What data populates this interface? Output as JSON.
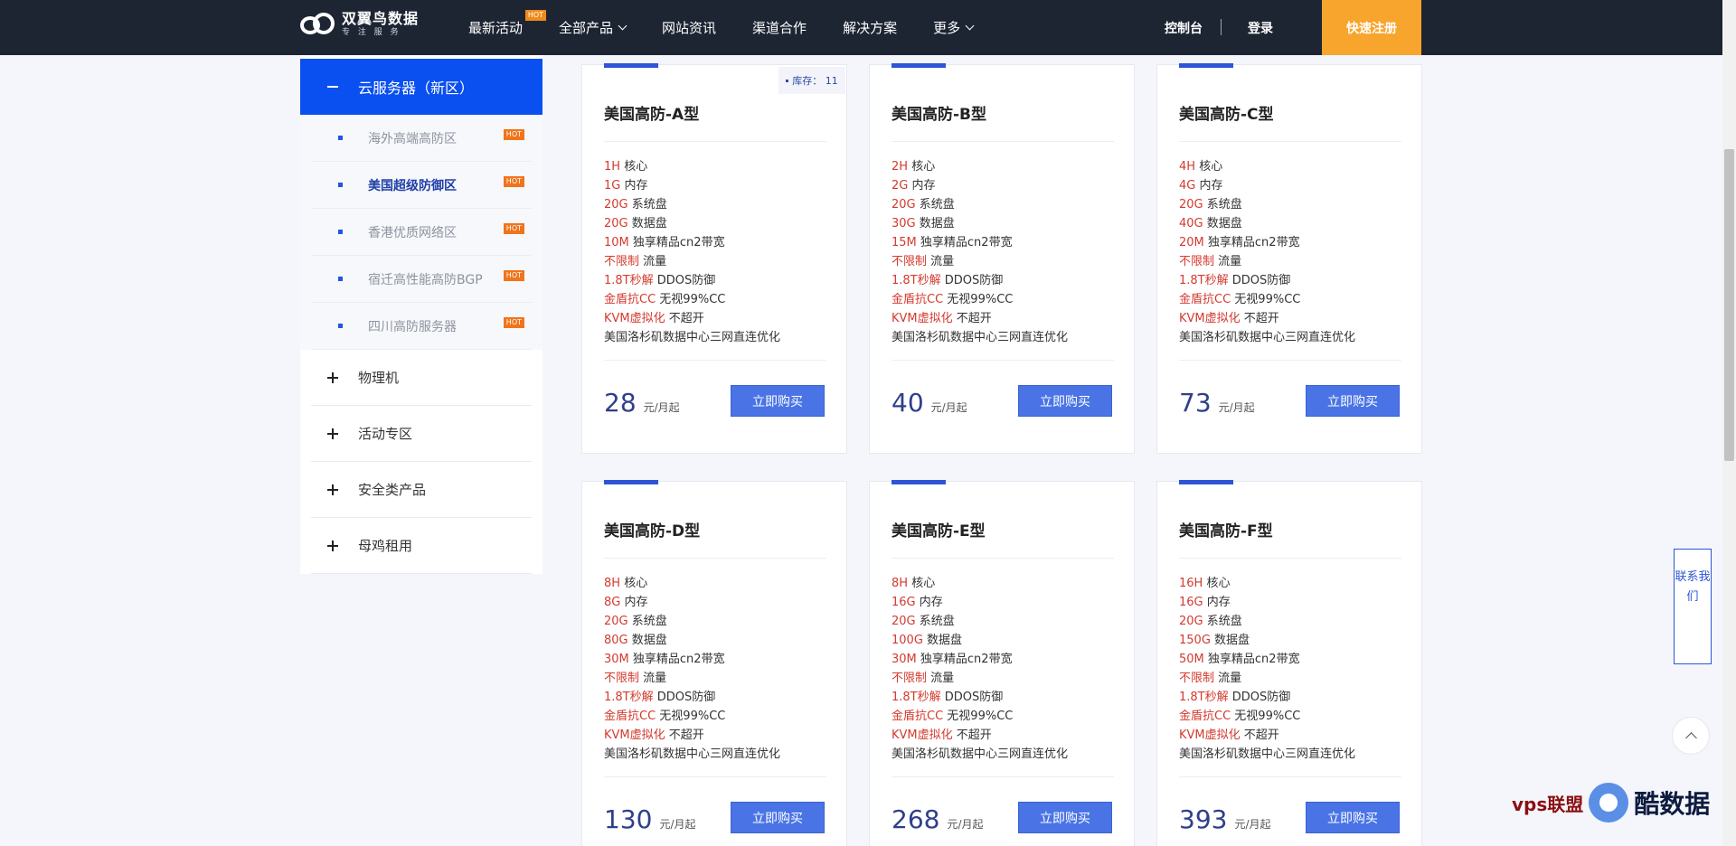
{
  "header": {
    "logo_name": "双翼鸟数据",
    "logo_sub": "专 注 服 务",
    "nav": [
      {
        "label": "最新活动",
        "hot": "HOT",
        "dropdown": false
      },
      {
        "label": "全部产品",
        "hot": "",
        "dropdown": true
      },
      {
        "label": "网站资讯",
        "hot": "",
        "dropdown": false
      },
      {
        "label": "渠道合作",
        "hot": "",
        "dropdown": false
      },
      {
        "label": "解决方案",
        "hot": "",
        "dropdown": false
      },
      {
        "label": "更多",
        "hot": "",
        "dropdown": true
      }
    ],
    "console": "控制台",
    "login": "登录",
    "register": "快速注册"
  },
  "sidebar": {
    "active": "云服务器（新区）",
    "subs": [
      {
        "label": "海外高端高防区",
        "hot": "HOT"
      },
      {
        "label": "美国超级防御区",
        "hot": "HOT"
      },
      {
        "label": "香港优质网络区",
        "hot": "HOT"
      },
      {
        "label": "宿迁高性能高防BGP",
        "hot": "HOT"
      },
      {
        "label": "四川高防服务器",
        "hot": "HOT"
      }
    ],
    "categories": [
      "物理机",
      "活动专区",
      "安全类产品",
      "母鸡租用"
    ]
  },
  "stock": {
    "label": "库存：",
    "value": "11"
  },
  "cards": [
    {
      "title": "美国高防-A型",
      "cpu": "1H",
      "mem": "1G",
      "sys": "20G",
      "data": "20G",
      "bw": "10M",
      "price": "28"
    },
    {
      "title": "美国高防-B型",
      "cpu": "2H",
      "mem": "2G",
      "sys": "20G",
      "data": "30G",
      "bw": "15M",
      "price": "40"
    },
    {
      "title": "美国高防-C型",
      "cpu": "4H",
      "mem": "4G",
      "sys": "20G",
      "data": "40G",
      "bw": "20M",
      "price": "73"
    },
    {
      "title": "美国高防-D型",
      "cpu": "8H",
      "mem": "8G",
      "sys": "20G",
      "data": "80G",
      "bw": "30M",
      "price": "130"
    },
    {
      "title": "美国高防-E型",
      "cpu": "8H",
      "mem": "16G",
      "sys": "20G",
      "data": "100G",
      "bw": "30M",
      "price": "268"
    },
    {
      "title": "美国高防-F型",
      "cpu": "16H",
      "mem": "16G",
      "sys": "20G",
      "data": "150G",
      "bw": "50M",
      "price": "393"
    }
  ],
  "spec_labels": {
    "cpu": "核心",
    "mem": "内存",
    "sys": "系统盘",
    "data": "数据盘",
    "bw": "独享精品cn2带宽",
    "traffic_hl": "不限制",
    "traffic": "流量",
    "ddos_hl": "1.8T秒解",
    "ddos": "DDOS防御",
    "cc_hl": "金盾抗CC",
    "cc": "无视99%CC",
    "kvm_hl": "KVM虚拟化",
    "kvm": "不超开",
    "dc": "美国洛杉矶数据中心三网直连优化"
  },
  "price_unit": "元/月起",
  "buy_label": "立即购买",
  "contact": "联系我们",
  "watermark": {
    "left": "vps联盟",
    "right": "酷数据"
  }
}
